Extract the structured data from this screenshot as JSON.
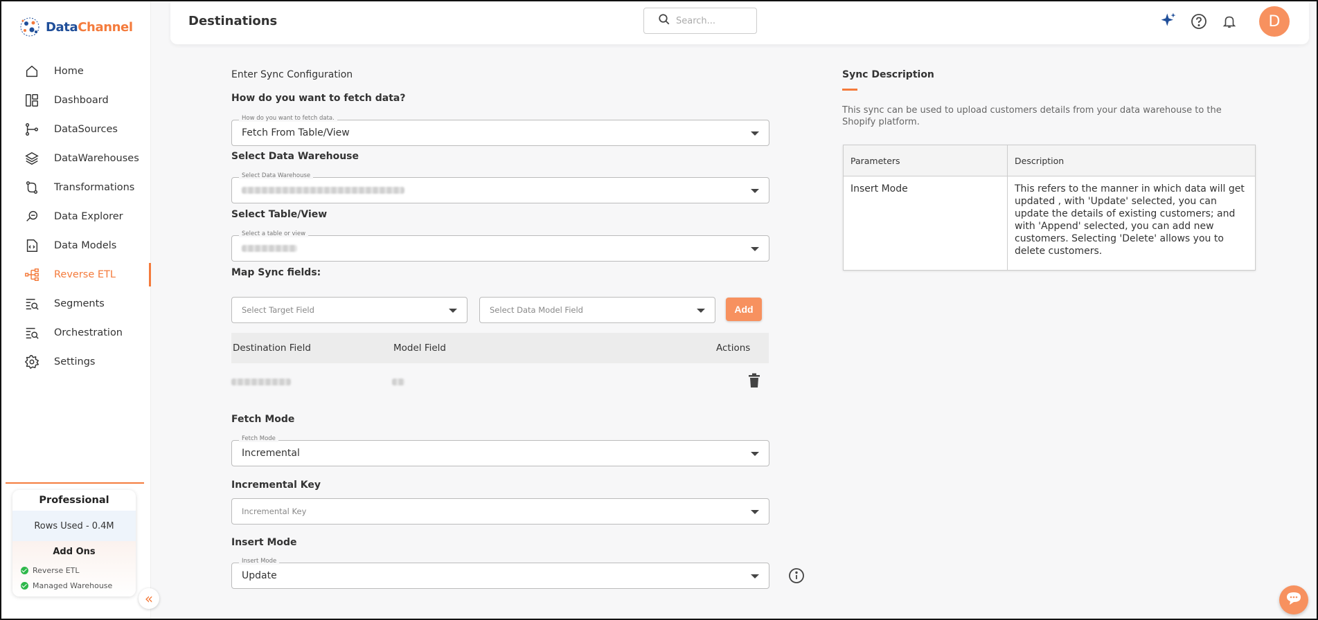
{
  "brand": {
    "name_a": "Data",
    "name_b": "Channel"
  },
  "sidebar": {
    "items": [
      {
        "label": "Home",
        "icon": "home-icon"
      },
      {
        "label": "Dashboard",
        "icon": "dashboard-icon"
      },
      {
        "label": "DataSources",
        "icon": "datasources-icon"
      },
      {
        "label": "DataWarehouses",
        "icon": "layers-icon"
      },
      {
        "label": "Transformations",
        "icon": "transform-icon"
      },
      {
        "label": "Data Explorer",
        "icon": "explorer-icon"
      },
      {
        "label": "Data Models",
        "icon": "data-model-icon"
      },
      {
        "label": "Reverse ETL",
        "icon": "reverse-etl-icon",
        "active": true
      },
      {
        "label": "Segments",
        "icon": "segments-icon"
      },
      {
        "label": "Orchestration",
        "icon": "orchestration-icon"
      },
      {
        "label": "Settings",
        "icon": "gear-icon"
      }
    ],
    "plan": {
      "title": "Professional",
      "rows_used": "Rows Used - 0.4M",
      "addons_title": "Add Ons",
      "addons": [
        "Reverse ETL",
        "Managed Warehouse"
      ]
    },
    "collapse_glyph": "«"
  },
  "header": {
    "title": "Destinations",
    "search_placeholder": "Search...",
    "avatar_letter": "D"
  },
  "form": {
    "section_title": "Enter Sync Configuration",
    "fetch_question": "How do you want to fetch data?",
    "fetch_legend": "How do you want to fetch data.",
    "fetch_value": "Fetch From Table/View",
    "warehouse_label": "Select Data Warehouse",
    "warehouse_legend": "Select Data Warehouse",
    "table_label": "Select Table/View",
    "table_legend": "Select a table or view",
    "map_label": "Map Sync fields:",
    "target_field_placeholder": "Select Target Field",
    "model_field_placeholder": "Select Data Model Field",
    "add_label": "Add",
    "map_columns": {
      "destination": "Destination Field",
      "model": "Model Field",
      "actions": "Actions"
    },
    "fetch_mode_label": "Fetch Mode",
    "fetch_mode_legend": "Fetch Mode",
    "fetch_mode_value": "Incremental",
    "incremental_key_label": "Incremental Key",
    "incremental_key_placeholder": "Incremental Key",
    "insert_mode_label": "Insert Mode",
    "insert_mode_legend": "Insert Mode",
    "insert_mode_value": "Update"
  },
  "description": {
    "title": "Sync Description",
    "text": "This sync can be used to upload customers details from your data warehouse to the Shopify platform.",
    "table_headers": {
      "parameters": "Parameters",
      "description": "Description"
    },
    "rows": [
      {
        "parameter": "Insert Mode",
        "description": "This refers to the manner in which data will get updated , with 'Update' selected, you can update the details of existing customers; and with 'Append' selected, you can add new customers. Selecting 'Delete' allows you to delete customers."
      }
    ]
  },
  "colors": {
    "accent": "#f47b3c",
    "brand_blue": "#1f4e99",
    "avatar": "#f7915f"
  }
}
